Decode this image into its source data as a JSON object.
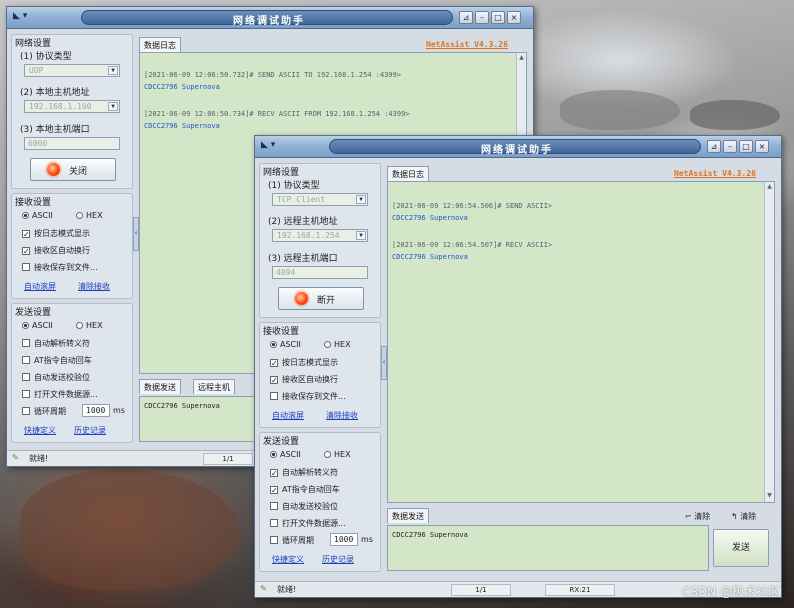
{
  "watermark": "CSDN @极术社区",
  "icons": {
    "window_menu": "window-menu-icon",
    "pin": "pin-icon",
    "minimize": "minimize-icon",
    "maximize": "maximize-icon",
    "close": "close-icon",
    "status_led": "status-light-icon"
  },
  "win1": {
    "title": "网络调试助手",
    "version": "NetAssist V4.3.26",
    "net_settings": {
      "title": "网络设置",
      "protocol_label": "(1) 协议类型",
      "protocol_value": "UDP",
      "host_label": "(2) 本地主机地址",
      "host_value": "192.168.1.100",
      "port_label": "(3) 本地主机端口",
      "port_value": "6000",
      "action_button": "关闭"
    },
    "recv_settings": {
      "title": "接收设置",
      "ascii": "ASCII",
      "hex": "HEX",
      "opt1": "按日志模式显示",
      "opt2": "接收区自动换行",
      "opt3": "接收保存到文件...",
      "link1": "自动滚屏",
      "link2": "清除接收"
    },
    "send_settings": {
      "title": "发送设置",
      "ascii": "ASCII",
      "hex": "HEX",
      "opt1": "自动解析转义符",
      "opt2": "AT指令自动回车",
      "opt3": "自动发送校验位",
      "opt4": "打开文件数据源...",
      "opt5": "循环周期",
      "period": "1000",
      "unit": "ms",
      "link1": "快捷定义",
      "link2": "历史记录"
    },
    "log_tab": "数据日志",
    "log": [
      {
        "header": "[2021-06-09 12:06:50.732]# SEND ASCII TO 192.168.1.254 :4399>",
        "data": "CDCC2796   Supernova"
      },
      {
        "header": "[2021-06-09 12:06:50.734]# RECV ASCII FROM 192.168.1.254 :4399>",
        "data": "CDCC2796   Supernova"
      }
    ],
    "send_tab": "数据发送",
    "remote_tab": "远程主机",
    "send_text": "CDCC2796   Supernova",
    "status": "就绪!",
    "status_count": "1/1"
  },
  "win2": {
    "title": "网络调试助手",
    "version": "NetAssist V4.3.26",
    "net_settings": {
      "title": "网络设置",
      "protocol_label": "(1) 协议类型",
      "protocol_value": "TCP Client",
      "host_label": "(2) 远程主机地址",
      "host_value": "192.168.1.254",
      "port_label": "(3) 远程主机端口",
      "port_value": "4094",
      "action_button": "断开"
    },
    "recv_settings": {
      "title": "接收设置",
      "ascii": "ASCII",
      "hex": "HEX",
      "opt1": "按日志模式显示",
      "opt2": "接收区自动换行",
      "opt3": "接收保存到文件...",
      "link1": "自动滚屏",
      "link2": "清除接收"
    },
    "send_settings": {
      "title": "发送设置",
      "ascii": "ASCII",
      "hex": "HEX",
      "opt1": "自动解析转义符",
      "opt2": "AT指令自动回车",
      "opt3": "自动发送校验位",
      "opt4": "打开文件数据源...",
      "opt5": "循环周期",
      "period": "1000",
      "unit": "ms",
      "link1": "快捷定义",
      "link2": "历史记录"
    },
    "log_tab": "数据日志",
    "log": [
      {
        "header": "[2021-06-09 12:06:54.506]# SEND ASCII>",
        "data": "CDCC2796   Supernova"
      },
      {
        "header": "[2021-06-09 12:06:54.507]# RECV ASCII>",
        "data": "CDCC2796   Supernova"
      }
    ],
    "send_tab": "数据发送",
    "clear1": "清除",
    "clear2": "清除",
    "send_text": "CDCC2796   Supernova",
    "send_button": "发送",
    "status": "就绪!",
    "status_count": "1/1",
    "status_rx": "RX:21"
  }
}
